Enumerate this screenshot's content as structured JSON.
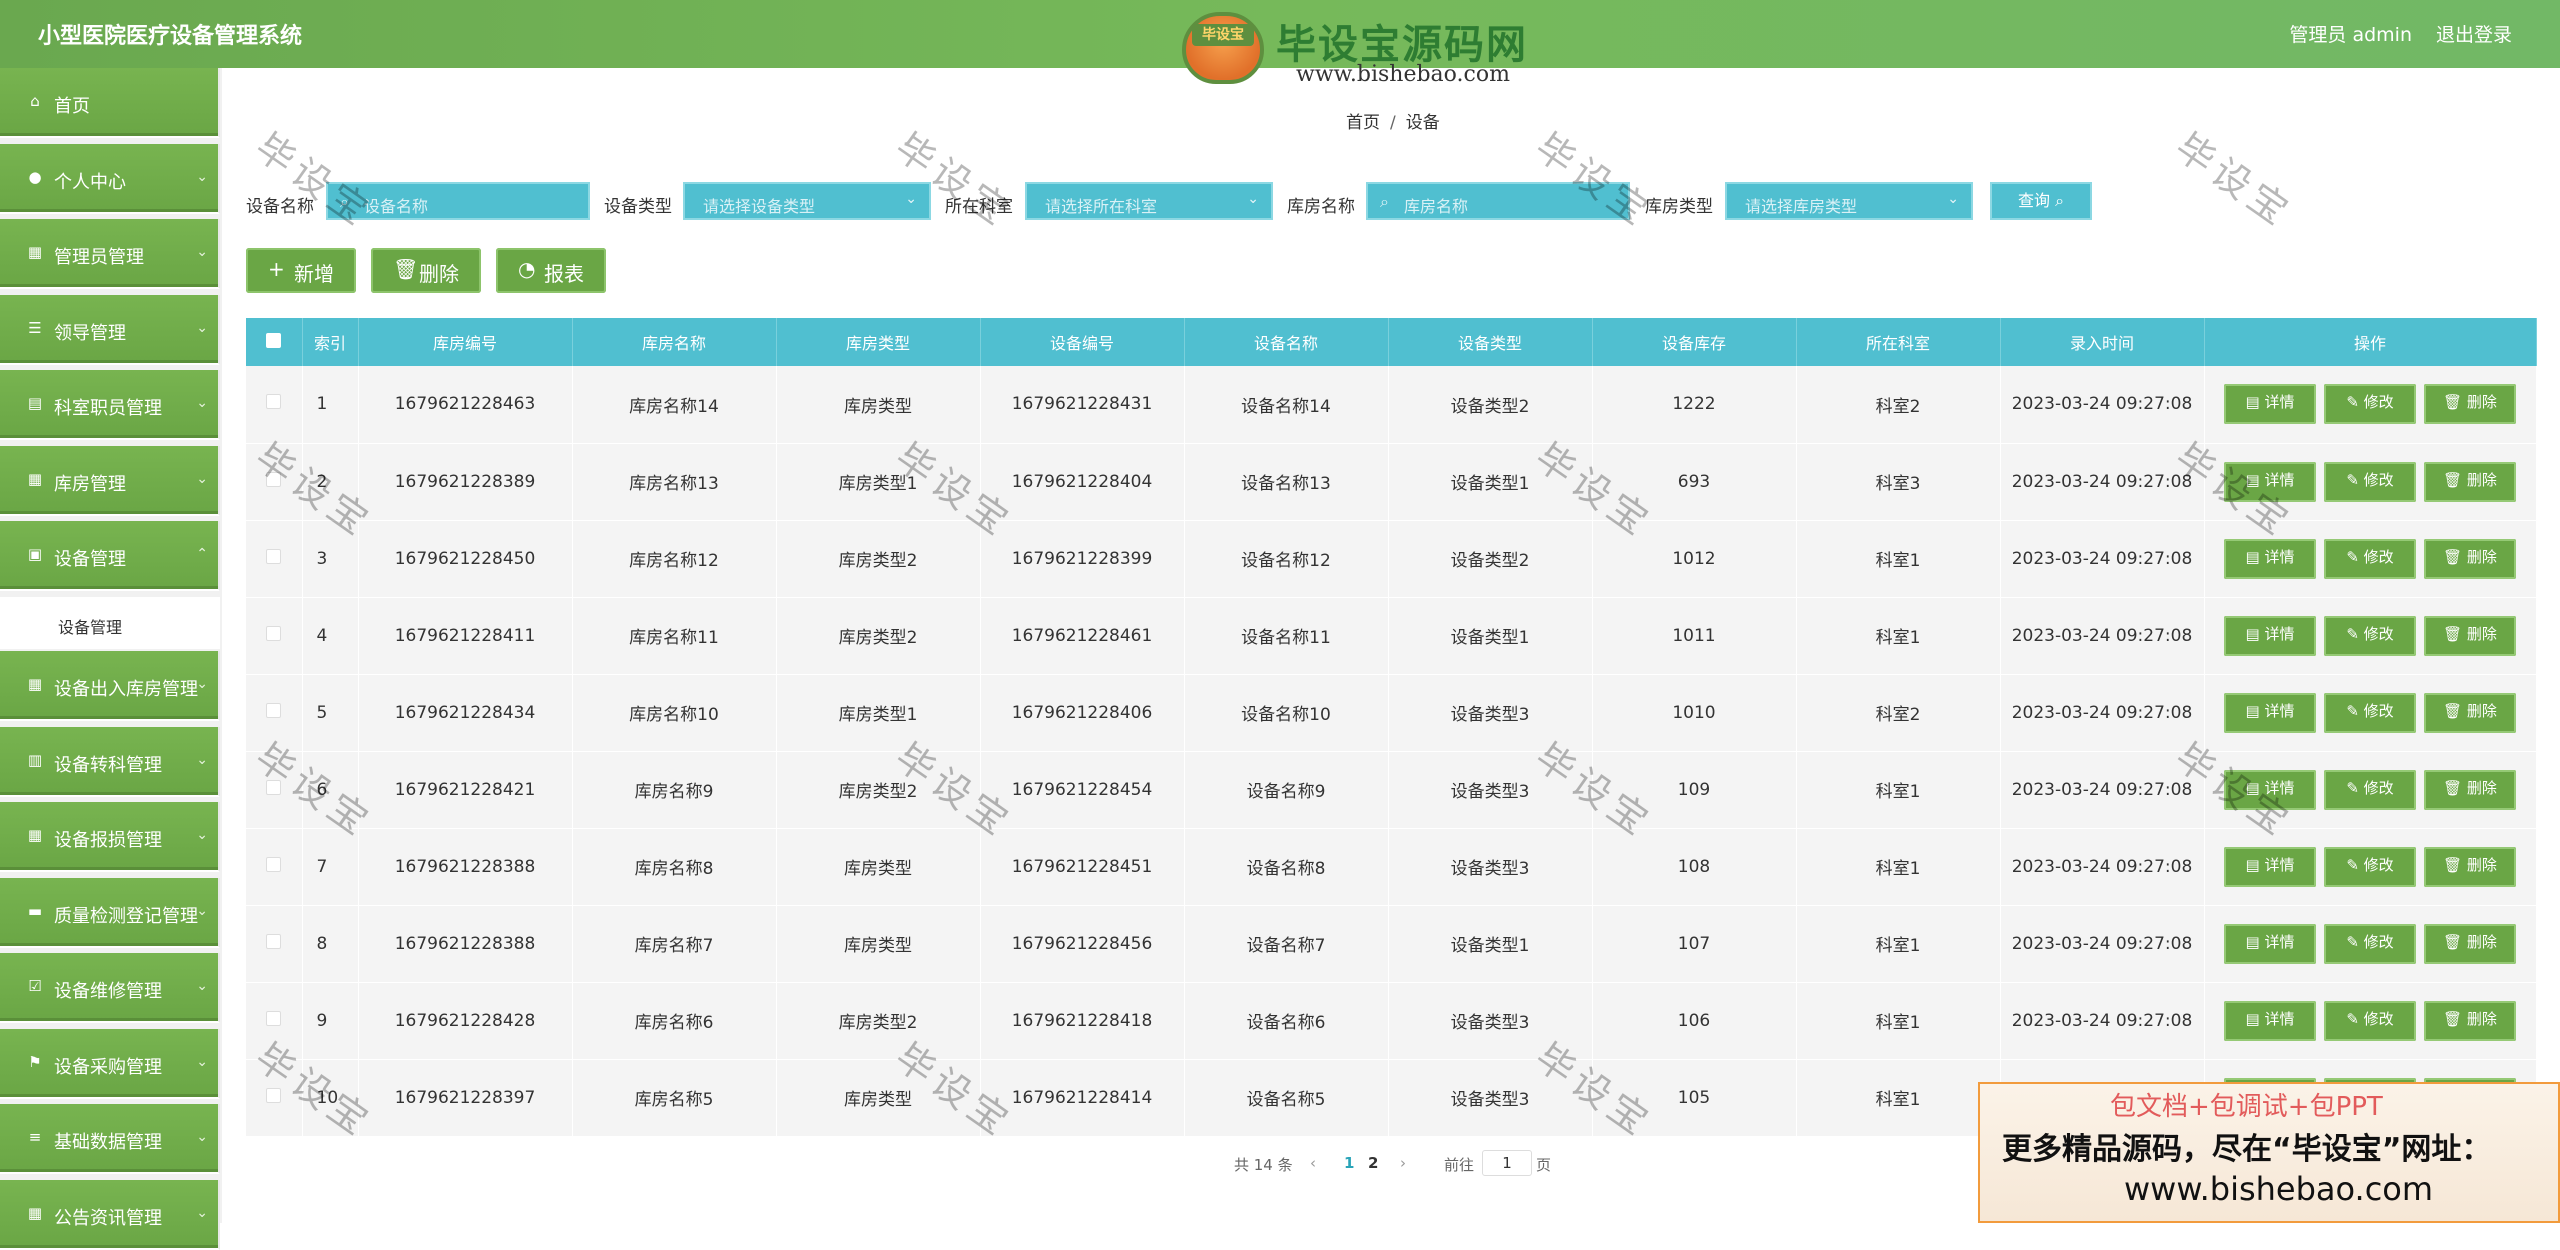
{
  "header": {
    "title": "小型医院医疗设备管理系统",
    "user": "管理员 admin",
    "logout": "退出登录",
    "brand_badge": "毕设宝",
    "brand_name": "毕设宝源码网",
    "brand_url": "www.bishebao.com"
  },
  "sidebar": {
    "items": [
      {
        "label": "首页",
        "icon": "home-icon"
      },
      {
        "label": "个人中心",
        "icon": "user-icon"
      },
      {
        "label": "管理员管理",
        "icon": "grid-icon"
      },
      {
        "label": "领导管理",
        "icon": "sliders-icon"
      },
      {
        "label": "科室职员管理",
        "icon": "table-icon"
      },
      {
        "label": "库房管理",
        "icon": "grid-icon"
      },
      {
        "label": "设备管理",
        "icon": "clipboard-icon"
      },
      {
        "label": "设备出入库房管理",
        "icon": "grid-icon"
      },
      {
        "label": "设备转科管理",
        "icon": "bar-chart-icon"
      },
      {
        "label": "设备报损管理",
        "icon": "grid-icon"
      },
      {
        "label": "质量检测登记管理",
        "icon": "chat-icon"
      },
      {
        "label": "设备维修管理",
        "icon": "check-square-icon"
      },
      {
        "label": "设备采购管理",
        "icon": "flag-icon"
      },
      {
        "label": "基础数据管理",
        "icon": "menu-icon"
      },
      {
        "label": "公告资讯管理",
        "icon": "grid-icon"
      }
    ],
    "sub_item": "设备管理"
  },
  "breadcrumb": {
    "home": "首页",
    "sep": "/",
    "current": "设备"
  },
  "search": {
    "device_name_label": "设备名称",
    "device_name_placeholder": "设备名称",
    "device_type_label": "设备类型",
    "device_type_placeholder": "请选择设备类型",
    "department_label": "所在科室",
    "department_placeholder": "请选择所在科室",
    "warehouse_name_label": "库房名称",
    "warehouse_name_placeholder": "库房名称",
    "warehouse_type_label": "库房类型",
    "warehouse_type_placeholder": "请选择库房类型",
    "query_button": "查询"
  },
  "actions": {
    "add": "新增",
    "delete": "删除",
    "report": "报表"
  },
  "table": {
    "headers": [
      "索引",
      "库房编号",
      "库房名称",
      "库房类型",
      "设备编号",
      "设备名称",
      "设备类型",
      "设备库存",
      "所在科室",
      "录入时间",
      "操作"
    ],
    "op_labels": {
      "detail": "详情",
      "edit": "修改",
      "delete": "删除"
    },
    "rows": [
      {
        "idx": "1",
        "wh_no": "1679621228463",
        "wh_name": "库房名称14",
        "wh_type": "库房类型",
        "dev_no": "1679621228431",
        "dev_name": "设备名称14",
        "dev_type": "设备类型2",
        "stock": "1222",
        "dept": "科室2",
        "time": "2023-03-24 09:27:08"
      },
      {
        "idx": "2",
        "wh_no": "1679621228389",
        "wh_name": "库房名称13",
        "wh_type": "库房类型1",
        "dev_no": "1679621228404",
        "dev_name": "设备名称13",
        "dev_type": "设备类型1",
        "stock": "693",
        "dept": "科室3",
        "time": "2023-03-24 09:27:08"
      },
      {
        "idx": "3",
        "wh_no": "1679621228450",
        "wh_name": "库房名称12",
        "wh_type": "库房类型2",
        "dev_no": "1679621228399",
        "dev_name": "设备名称12",
        "dev_type": "设备类型2",
        "stock": "1012",
        "dept": "科室1",
        "time": "2023-03-24 09:27:08"
      },
      {
        "idx": "4",
        "wh_no": "1679621228411",
        "wh_name": "库房名称11",
        "wh_type": "库房类型2",
        "dev_no": "1679621228461",
        "dev_name": "设备名称11",
        "dev_type": "设备类型1",
        "stock": "1011",
        "dept": "科室1",
        "time": "2023-03-24 09:27:08"
      },
      {
        "idx": "5",
        "wh_no": "1679621228434",
        "wh_name": "库房名称10",
        "wh_type": "库房类型1",
        "dev_no": "1679621228406",
        "dev_name": "设备名称10",
        "dev_type": "设备类型3",
        "stock": "1010",
        "dept": "科室2",
        "time": "2023-03-24 09:27:08"
      },
      {
        "idx": "6",
        "wh_no": "1679621228421",
        "wh_name": "库房名称9",
        "wh_type": "库房类型2",
        "dev_no": "1679621228454",
        "dev_name": "设备名称9",
        "dev_type": "设备类型3",
        "stock": "109",
        "dept": "科室1",
        "time": "2023-03-24 09:27:08"
      },
      {
        "idx": "7",
        "wh_no": "1679621228388",
        "wh_name": "库房名称8",
        "wh_type": "库房类型",
        "dev_no": "1679621228451",
        "dev_name": "设备名称8",
        "dev_type": "设备类型3",
        "stock": "108",
        "dept": "科室1",
        "time": "2023-03-24 09:27:08"
      },
      {
        "idx": "8",
        "wh_no": "1679621228388",
        "wh_name": "库房名称7",
        "wh_type": "库房类型",
        "dev_no": "1679621228456",
        "dev_name": "设备名称7",
        "dev_type": "设备类型1",
        "stock": "107",
        "dept": "科室1",
        "time": "2023-03-24 09:27:08"
      },
      {
        "idx": "9",
        "wh_no": "1679621228428",
        "wh_name": "库房名称6",
        "wh_type": "库房类型2",
        "dev_no": "1679621228418",
        "dev_name": "设备名称6",
        "dev_type": "设备类型3",
        "stock": "106",
        "dept": "科室1",
        "time": "2023-03-24 09:27:08"
      },
      {
        "idx": "10",
        "wh_no": "1679621228397",
        "wh_name": "库房名称5",
        "wh_type": "库房类型",
        "dev_no": "1679621228414",
        "dev_name": "设备名称5",
        "dev_type": "设备类型3",
        "stock": "105",
        "dept": "科室1",
        "time": ""
      }
    ]
  },
  "pagination": {
    "total": "共 14 条",
    "pages": [
      "1",
      "2"
    ],
    "current_page": "1",
    "goto_label": "前往",
    "goto_value": "1",
    "page_unit": "页"
  },
  "watermark": "毕设宝",
  "ad": {
    "line1": "包文档+包调试+包PPT",
    "line2": "更多精品源码，尽在“毕设宝”网址：",
    "line3": "www.bishebao.com"
  },
  "colors": {
    "primary_green": "#6aa645",
    "accent_cyan": "#50bfd0",
    "header_green": "#72b866"
  }
}
